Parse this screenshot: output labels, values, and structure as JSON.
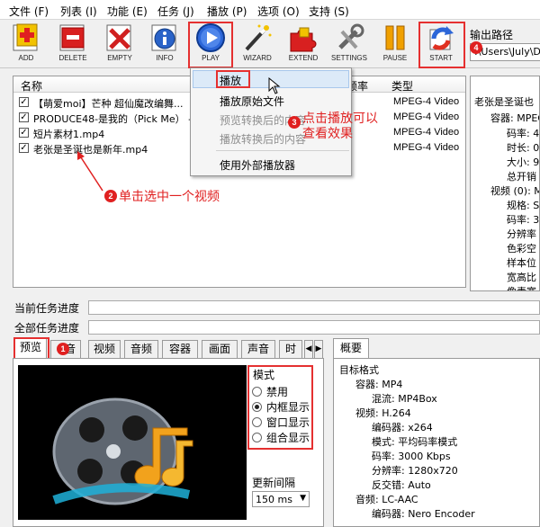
{
  "menu": [
    "文件 (F)",
    "列表 (I)",
    "功能 (E)",
    "任务 (J)",
    "播放 (P)",
    "选项 (O)",
    "支持 (S)"
  ],
  "toolbar": {
    "add": "ADD",
    "delete": "DELETE",
    "empty": "EMPTY",
    "info": "INFO",
    "play": "PLAY",
    "wizard": "WIZARD",
    "extend": "EXTEND",
    "settings": "SETTINGS",
    "pause": "PAUSE",
    "start": "START"
  },
  "output": {
    "label": "输出路径",
    "path": ":\\Users\\July\\D"
  },
  "filelist": {
    "headers": {
      "name": "名称",
      "rate": "频率",
      "type": "类型"
    },
    "rows": [
      {
        "name": "【萌爱moi】芒种 超仙魔改编舞...",
        "type": "MPEG-4 Video"
      },
      {
        "name": "PRODUCE48-是我的（Pick Me） -...",
        "type": "MPEG-4 Video"
      },
      {
        "name": "短片素材1.mp4",
        "type": "MPEG-4 Video"
      },
      {
        "name": "老张是圣诞也是新年.mp4",
        "type": "MPEG-4 Video"
      }
    ]
  },
  "context_menu": {
    "play": "播放",
    "play_original": "播放原始文件",
    "preview_converted": "预览转换后的内容",
    "play_converted": "播放转换后的内容",
    "external_player": "使用外部播放器"
  },
  "annotations": {
    "a1": "1",
    "a2_num": "2",
    "a2": "单击选中一个视频",
    "a3_num": "3",
    "a3_line1": "点击播放可以",
    "a3_line2": "查看效果",
    "a4": "4"
  },
  "right_tree": [
    "老张是圣诞也",
    "容器: MPEG",
    "码率: 4",
    "时长: 0",
    "大小: 9",
    "总开销",
    "视频 (0): M",
    "规格: S",
    "码率: 3",
    "分辨率",
    "色彩空",
    "样本位",
    "宽高比",
    "像素宽"
  ],
  "progress": {
    "current": "当前任务进度",
    "all": "全部任务进度"
  },
  "tabs": [
    "预览",
    "音",
    "视频",
    "音频",
    "容器",
    "画面",
    "声音",
    "时"
  ],
  "mode": {
    "title": "模式",
    "options": [
      "禁用",
      "内框显示",
      "窗口显示",
      "组合显示"
    ],
    "selected": "内框显示",
    "interval_label": "更新间隔",
    "interval_value": "150 ms"
  },
  "summary": {
    "tab": "概要",
    "lines": [
      "目标格式",
      "容器: MP4",
      "混流: MP4Box",
      "视频: H.264",
      "编码器: x264",
      "模式: 平均码率模式",
      "码率: 3000 Kbps",
      "分辨率: 1280x720",
      "反交错: Auto",
      "音频: LC-AAC",
      "编码器: Nero Encoder"
    ]
  },
  "colors": {
    "annotation_red": "#e02020",
    "menu_highlight": "#dceaf8"
  }
}
